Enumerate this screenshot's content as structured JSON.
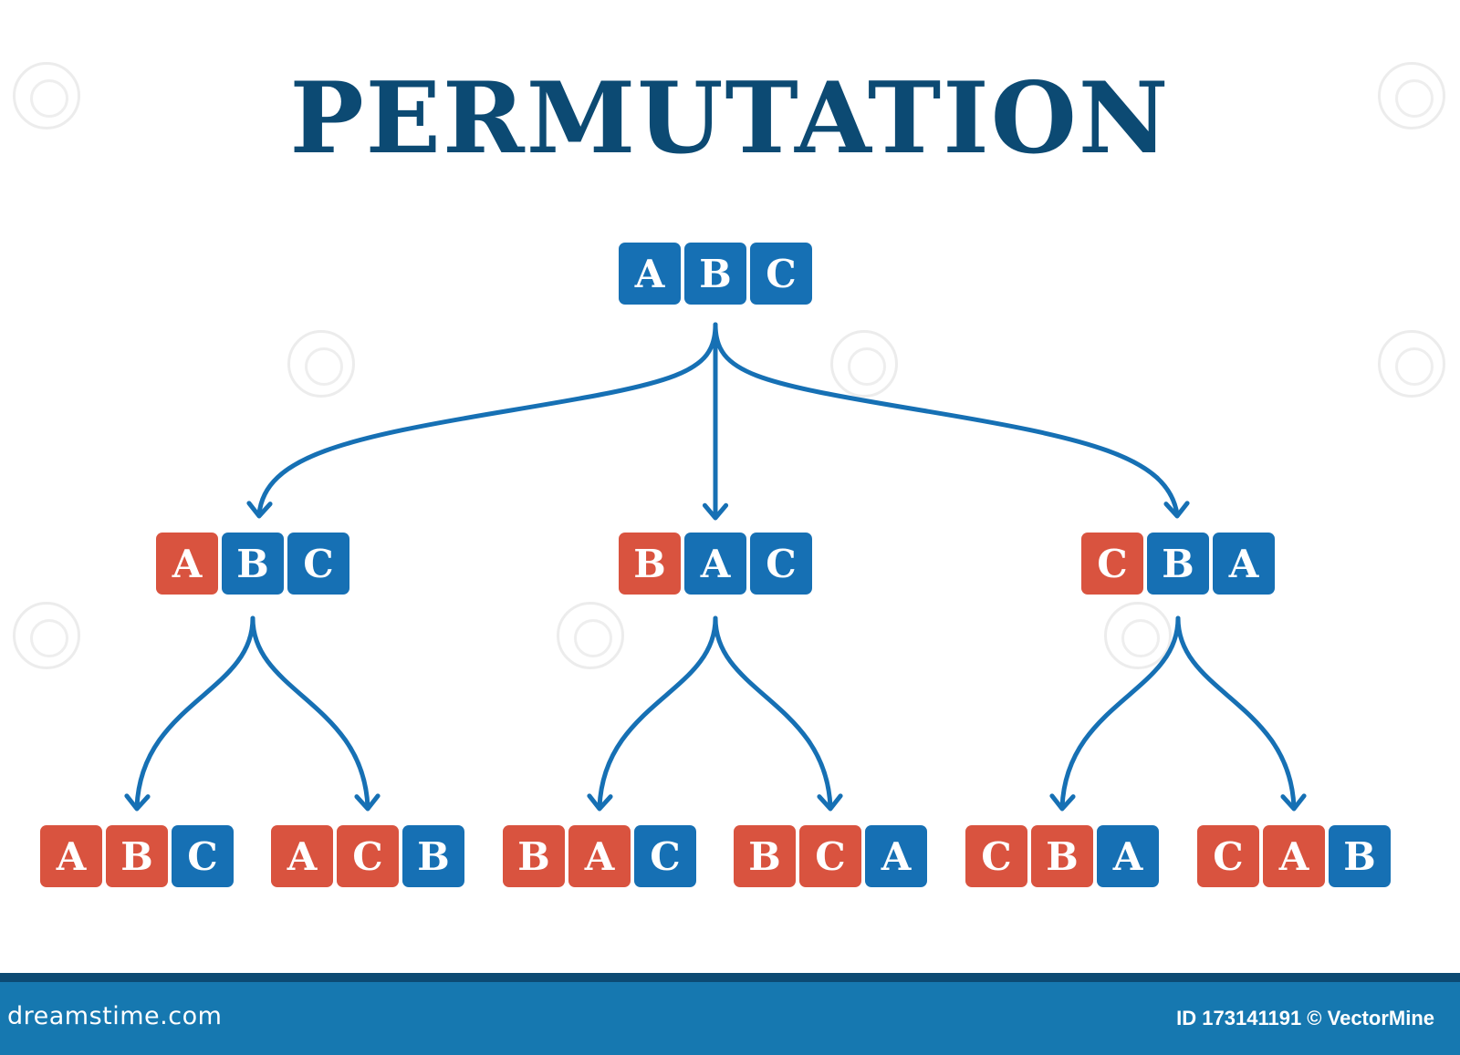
{
  "title": "PERMUTATION",
  "colors": {
    "blue": "#1670b4",
    "red": "#d9533f",
    "title": "#0c4a73",
    "arrow": "#1670b4",
    "footer_bg": "#1678b0",
    "footer_band": "#0c4a73"
  },
  "tree": {
    "root": [
      [
        "A",
        "blue"
      ],
      [
        "B",
        "blue"
      ],
      [
        "C",
        "blue"
      ]
    ],
    "level1": [
      [
        [
          "A",
          "red"
        ],
        [
          "B",
          "blue"
        ],
        [
          "C",
          "blue"
        ]
      ],
      [
        [
          "B",
          "red"
        ],
        [
          "A",
          "blue"
        ],
        [
          "C",
          "blue"
        ]
      ],
      [
        [
          "C",
          "red"
        ],
        [
          "B",
          "blue"
        ],
        [
          "A",
          "blue"
        ]
      ]
    ],
    "level2": [
      [
        [
          "A",
          "red"
        ],
        [
          "B",
          "red"
        ],
        [
          "C",
          "blue"
        ]
      ],
      [
        [
          "A",
          "red"
        ],
        [
          "C",
          "red"
        ],
        [
          "B",
          "blue"
        ]
      ],
      [
        [
          "B",
          "red"
        ],
        [
          "A",
          "red"
        ],
        [
          "C",
          "blue"
        ]
      ],
      [
        [
          "B",
          "red"
        ],
        [
          "C",
          "red"
        ],
        [
          "A",
          "blue"
        ]
      ],
      [
        [
          "C",
          "red"
        ],
        [
          "B",
          "red"
        ],
        [
          "A",
          "blue"
        ]
      ],
      [
        [
          "C",
          "red"
        ],
        [
          "A",
          "red"
        ],
        [
          "B",
          "blue"
        ]
      ]
    ]
  },
  "footer": {
    "logo": "dreamstime.com",
    "credit": "ID 173141191 © VectorMine"
  }
}
